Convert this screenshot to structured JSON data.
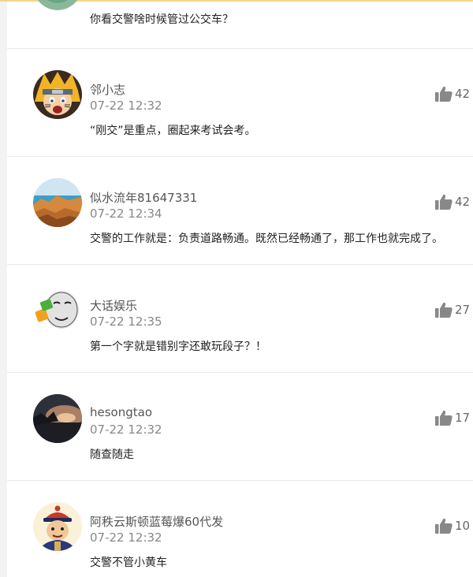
{
  "comments": [
    {
      "content": "你看交警啥时候管过公交车？",
      "avatar": "avatar-green-circle"
    },
    {
      "username": "邻小志",
      "time": "07-22 12:32",
      "content": "“刚交”是重点，圈起来考试会考。",
      "likes": "42",
      "avatar": "avatar-anime-boy"
    },
    {
      "username": "似水流年81647331",
      "time": "07-22 12:34",
      "content": "交警的工作就是：负责道路畅通。既然已经畅通了，那工作也就完成了。",
      "likes": "42",
      "avatar": "avatar-coastal-landscape"
    },
    {
      "username": "大话娱乐",
      "time": "07-22 12:35",
      "content": "第一个字就是错别字还敢玩段子？！",
      "likes": "27",
      "avatar": "avatar-meme-face"
    },
    {
      "username": "hesongtao",
      "time": "07-22 12:32",
      "content": "随查随走",
      "likes": "17",
      "avatar": "avatar-sunset-photo"
    },
    {
      "username": "阿秩云斯顿蓝莓爆60代发",
      "time": "07-22 12:32",
      "content": "交警不管小黄车",
      "likes": "10",
      "avatar": "avatar-qing-official-cartoon"
    }
  ],
  "icons": {
    "like": "thumbs-up-icon"
  },
  "colors": {
    "username": "#555555",
    "timestamp": "#888888",
    "content": "#222222",
    "like_icon": "#888888",
    "divider": "#e8e8e8",
    "top_accent": "#f2d68c"
  }
}
